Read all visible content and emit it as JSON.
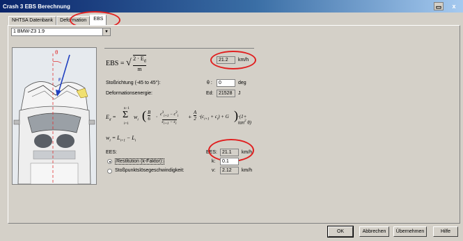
{
  "window": {
    "title": "Crash 3 EBS Berechnung",
    "restore_icon": "restore-icon",
    "close_label": "x"
  },
  "tabs": [
    {
      "label": "NHTSA Datenbank"
    },
    {
      "label": "Deformation"
    },
    {
      "label": "EBS"
    }
  ],
  "vehicle_select": {
    "value": "1  BMW-Z3 1.9"
  },
  "formulas": {
    "ebs_lhs": "EBS",
    "ebs_frac_num": "2 · E",
    "ebs_frac_num_sub": "d",
    "ebs_frac_den": "m",
    "energy": "E_d = Σ w_i ( B/6 · (c³_{i+1} − c³_i)/(c_{i+1} − c_i) + A/2 · (c_{i+1} + c_i) + G ) · (1 + tan² θ)",
    "sum_top": "n−1",
    "sum_bottom": "i=1",
    "width_def": "w_i = L_{i+1} − L_i"
  },
  "ebs": {
    "value": "21.2",
    "unit": "km/h"
  },
  "stoss": {
    "label": "Stoßrichtung (-45 to 45°):",
    "symbol": "θ :",
    "value": "0",
    "unit": "deg"
  },
  "energie": {
    "label": "Deformationsenergie:",
    "symbol": "Ed:",
    "value": "21528",
    "unit": "J"
  },
  "ees": {
    "label": "EES:",
    "symbol": "EES:",
    "value": "21.1",
    "unit": "km/h"
  },
  "restitution": {
    "label": "Restitution (k-Faktor):",
    "symbol": "k:",
    "value": "0.1",
    "selected": true
  },
  "stosspunkt": {
    "label": "Stoßpunktslösegeschwindigkeit:",
    "symbol": "v:",
    "value": "2.12",
    "unit": "km/h",
    "selected": false
  },
  "car_diagram": {
    "angle_label": "θ",
    "force_label": "F"
  },
  "buttons": {
    "ok": "OK",
    "abbrechen": "Abbrechen",
    "uebernehmen": "Übernehmen",
    "hilfe": "Hilfe"
  },
  "colors": {
    "annotation_red": "#e02020",
    "title_blue": "#0a246a"
  }
}
